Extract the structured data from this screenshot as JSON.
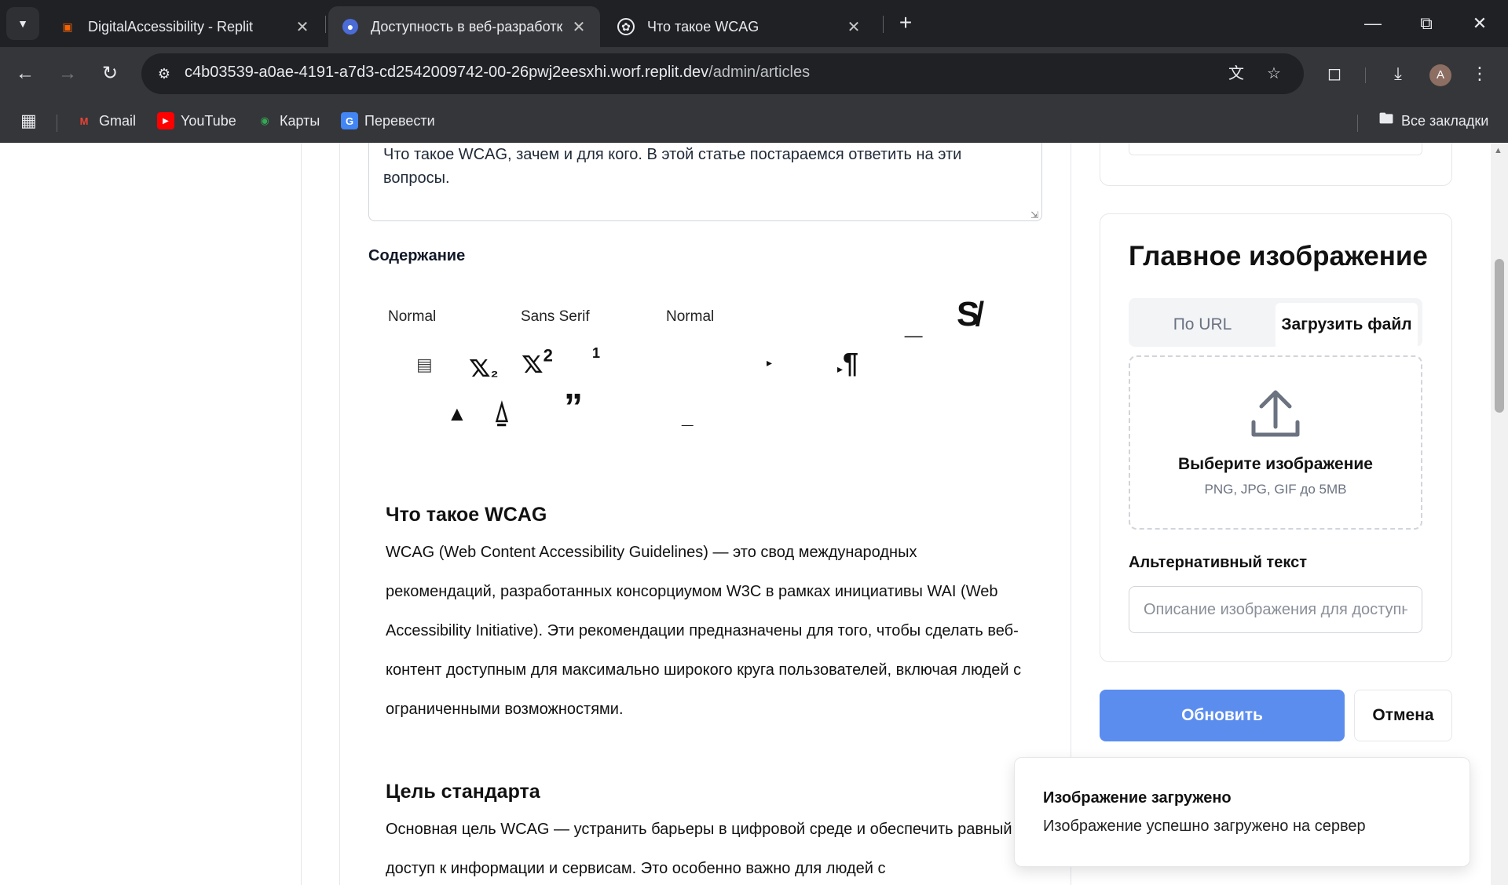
{
  "browser": {
    "tabs": [
      {
        "title": "DigitalAccessibility - Replit",
        "favicon": "replit-icon",
        "active": false
      },
      {
        "title": "Доступность в веб-разработке",
        "favicon": "globe-icon",
        "active": true
      },
      {
        "title": "Что такое WCAG",
        "favicon": "openai-icon",
        "active": false
      }
    ],
    "url": {
      "host": "c4b03539-a0ae-4191-a7d3-cd2542009742-00-26pwj2eesxhi.worf.replit.dev",
      "path": "/admin/articles"
    },
    "avatar_letter": "A",
    "bookmarks": [
      {
        "label": "Gmail",
        "icon": "gmail-icon",
        "color": "#ea4335"
      },
      {
        "label": "YouTube",
        "icon": "youtube-icon",
        "color": "#ff0000"
      },
      {
        "label": "Карты",
        "icon": "maps-icon",
        "color": "#34a853"
      },
      {
        "label": "Перевести",
        "icon": "translate-icon",
        "color": "#4285f4"
      }
    ],
    "all_bookmarks": "Все закладки"
  },
  "article": {
    "description": "Что такое WCAG, зачем и для кого. В этой статье постараемся ответить на эти вопросы.",
    "content_label": "Содержание",
    "toolbar": {
      "header_picker": "Normal",
      "font_picker": "Sans Serif",
      "size_picker": "Normal",
      "subscript": "x₂",
      "superscript": "x²"
    },
    "content": {
      "h1": "Что такое WCAG",
      "p1": "WCAG (Web Content Accessibility Guidelines) — это свод международных рекомендаций, разработанных консорциумом W3C в рамках инициативы WAI (Web Accessibility Initiative). Эти рекомендации предназначены для того, чтобы сделать веб-контент доступным для максимально широкого круга пользователей, включая людей с ограниченными возможностями.",
      "h2": "Цель стандарта",
      "p2": "Основная цель WCAG — устранить барьеры в цифровой среде и обеспечить равный доступ к информации и сервисам. Это особенно важно для людей с"
    }
  },
  "image_panel": {
    "title": "Главное изображение",
    "tab_url": "По URL",
    "tab_upload": "Загрузить файл",
    "drop_title": "Выберите изображение",
    "drop_hint": "PNG, JPG, GIF до 5MB",
    "alt_label": "Альтернативный текст",
    "alt_placeholder": "Описание изображения для доступности"
  },
  "actions": {
    "update": "Обновить",
    "cancel": "Отмена"
  },
  "toast": {
    "title": "Изображение загружено",
    "message": "Изображение успешно загружено на сервер"
  },
  "colors": {
    "primary": "#5b8def",
    "chrome_dark": "#202124",
    "chrome_mid": "#35363a"
  }
}
